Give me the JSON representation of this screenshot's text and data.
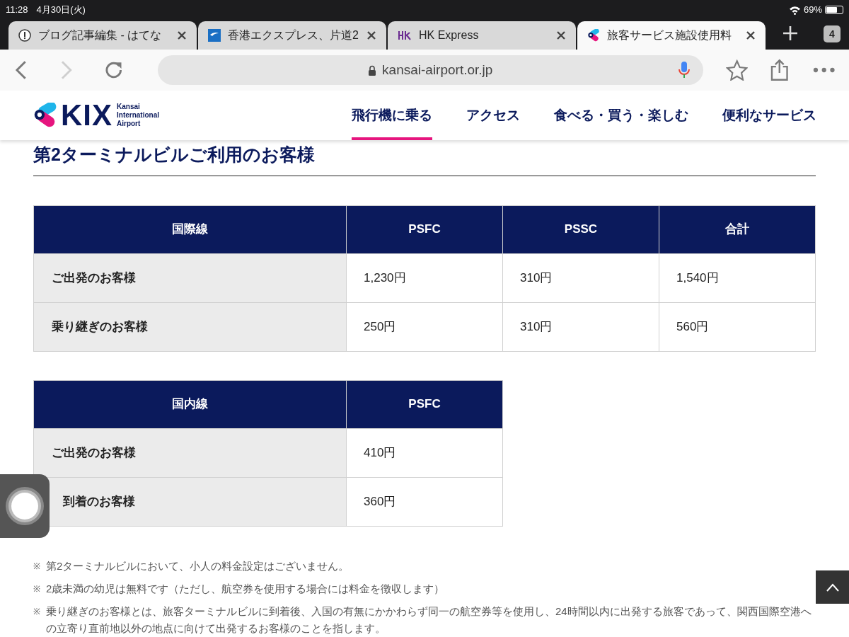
{
  "status_bar": {
    "time": "11:28",
    "date": "4月30日(火)",
    "battery_text": "69%"
  },
  "tabs": [
    {
      "title": "ブログ記事編集 - はてな",
      "selected": false,
      "kind": "hatena"
    },
    {
      "title": "香港エクスプレス、片道2",
      "selected": false,
      "kind": "lcc"
    },
    {
      "title": "HK Express",
      "selected": false,
      "kind": "hk"
    },
    {
      "title": "旅客サービス施設使用料",
      "selected": true,
      "kind": "kix"
    }
  ],
  "tab_count": "4",
  "address_bar": {
    "url": "kansai-airport.or.jp"
  },
  "site_header": {
    "logo_text": "KIX",
    "logo_sub": [
      "Kansai",
      "International",
      "Airport"
    ],
    "nav": [
      {
        "label": "飛行機に乗る",
        "selected": true
      },
      {
        "label": "アクセス",
        "selected": false
      },
      {
        "label": "食べる・買う・楽しむ",
        "selected": false
      },
      {
        "label": "便利なサービス",
        "selected": false
      }
    ]
  },
  "heading": "第2ターミナルビルご利用のお客様",
  "tables": [
    {
      "columns": [
        "国際線",
        "PSFC",
        "PSSC",
        "合計"
      ],
      "rows": [
        [
          "ご出発のお客様",
          "1,230円",
          "310円",
          "1,540円"
        ],
        [
          "乗り継ぎのお客様",
          "250円",
          "310円",
          "560円"
        ]
      ]
    },
    {
      "columns": [
        "国内線",
        "PSFC"
      ],
      "rows": [
        [
          "ご出発のお客様",
          "410円"
        ],
        [
          "到着のお客様",
          "360円"
        ]
      ]
    }
  ],
  "notes": [
    {
      "mark": "※",
      "text": "第2ターミナルビルにおいて、小人の料金設定はございません。"
    },
    {
      "mark": "※",
      "text": "2歳未満の幼児は無料です（ただし、航空券を使用する場合には料金を徴収します）"
    },
    {
      "mark": "※",
      "text": "乗り継ぎのお客様とは、旅客ターミナルビルに到着後、入国の有無にかかわらず同一の航空券等を使用し、24時間以内に出発する旅客であって、関西国際空港への立寄り直前地以外の地点に向けて出発するお客様のことを指します。"
    }
  ]
}
